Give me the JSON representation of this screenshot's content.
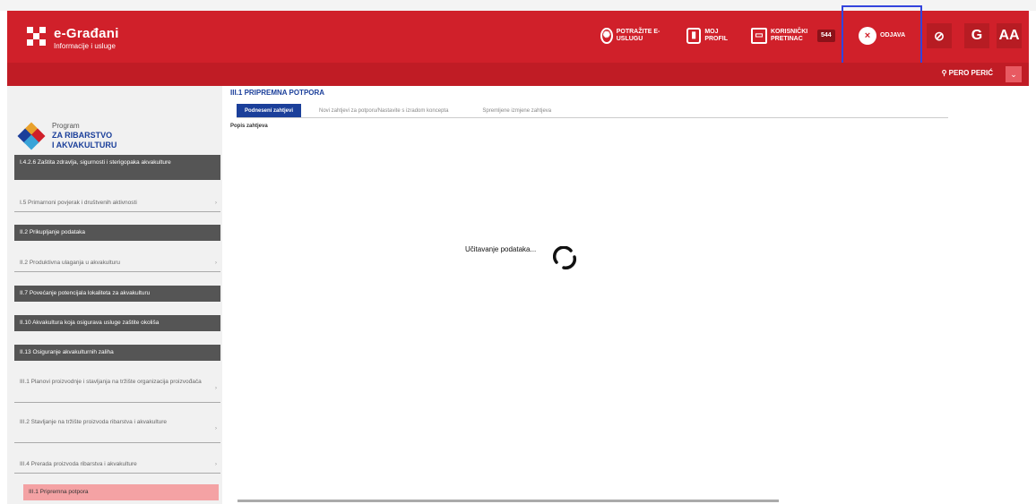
{
  "header": {
    "brand_title": "e-Građani",
    "brand_subtitle": "Informacije i usluge",
    "buttons": [
      {
        "label": "POTRAŽITE E-USLUGU",
        "icon": "globe-icon"
      },
      {
        "label": "MOJ PROFIL",
        "icon": "profile-icon"
      },
      {
        "label": "KORISNIČKI PRETINAC",
        "icon": "mailbox-icon",
        "badge": "544"
      },
      {
        "label": "ODJAVA",
        "icon": "close-circle-icon"
      }
    ],
    "visibility_icon": "eye-off-icon",
    "font_button_label": "G",
    "text_size_label": "AA"
  },
  "subbar": {
    "user_name": "PERO PERIĆ",
    "user_icon": "person-icon",
    "dropdown_icon": "chevron-down-icon"
  },
  "sidebar": {
    "program_line1": "Program",
    "program_line2": "ZA RIBARSTVO",
    "program_line3": "I AKVAKULTURU",
    "items": [
      {
        "label": "I.4.2.6 Zaštita zdravlja, sigurnosti i sterigopaka akvakulture",
        "style": "dark"
      },
      {
        "label": "I.5 Primarnoni povjerak i društvenih aktivnosti",
        "style": "light"
      },
      {
        "label": "II.2 Prikupljanje podataka",
        "style": "dark"
      },
      {
        "label": "II.2 Produktivna ulaganja u akvakulturu",
        "style": "light"
      },
      {
        "label": "II.7 Povećanje potencijala lokaliteta za akvakulturu",
        "style": "dark"
      },
      {
        "label": "II.10 Akvakultura koja osigurava usluge zaštite okoliša",
        "style": "dark"
      },
      {
        "label": "II.13 Osiguranje akvakulturnih zaliha",
        "style": "dark"
      },
      {
        "label": "III.1 Planovi proizvodnje i stavljanja na tržište organizacija proizvođača",
        "style": "light"
      },
      {
        "label": "III.2 Stavljanje na tržište proizvoda ribarstva i akvakulture",
        "style": "light"
      },
      {
        "label": "III.4 Prerada proizvoda ribarstva i akvakulture",
        "style": "light"
      },
      {
        "label": "III.1 Pripremna potpora",
        "style": "active"
      }
    ]
  },
  "main": {
    "title": "III.1 PRIPREMNA POTPORA",
    "tabs": [
      {
        "label": "Podnesení zahtjevi",
        "active": true
      },
      {
        "label": "Novi zahtjevi za potporu/Nastavite s izradom koncepta",
        "active": false
      },
      {
        "label": "Spremljene izmjene zahtjeva",
        "active": false
      }
    ],
    "subtitle": "Popis zahtjeva",
    "loading_text": "Učitavanje podataka..."
  }
}
